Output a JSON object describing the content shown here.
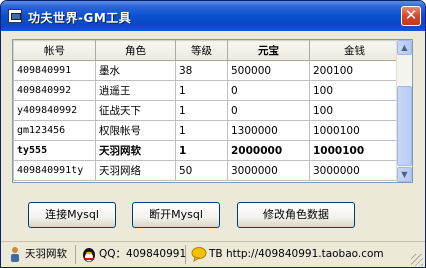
{
  "window": {
    "title": "功夫世界-GM工具",
    "close_symbol": "✕"
  },
  "table": {
    "columns": [
      "帐号",
      "角色",
      "等级",
      "元宝",
      "金钱"
    ],
    "rows": [
      {
        "account": "409840991",
        "role": "墨水",
        "level": "38",
        "yuanbao": "500000",
        "money": "200100",
        "bold": false
      },
      {
        "account": "409840992",
        "role": "逍遥王",
        "level": "1",
        "yuanbao": "0",
        "money": "100",
        "bold": false
      },
      {
        "account": "y409840992",
        "role": "征战天下",
        "level": "1",
        "yuanbao": "0",
        "money": "100",
        "bold": false
      },
      {
        "account": "gm123456",
        "role": "权限帐号",
        "level": "1",
        "yuanbao": "1300000",
        "money": "1000100",
        "bold": false
      },
      {
        "account": "ty555",
        "role": "天羽网软",
        "level": "1",
        "yuanbao": "2000000",
        "money": "1000100",
        "bold": true
      },
      {
        "account": "409840991ty",
        "role": "天羽网络",
        "level": "50",
        "yuanbao": "3000000",
        "money": "3000000",
        "bold": false
      }
    ]
  },
  "buttons": {
    "connect": "连接Mysql",
    "disconnect": "断开Mysql",
    "modify": "修改角色数据"
  },
  "statusbar": {
    "brand": "天羽网软",
    "qq": "QQ：409840991",
    "tb": "TB http://409840991.taobao.com"
  },
  "icons": {
    "title": "app-window-icon",
    "brand": "person-icon",
    "qq": "penguin-icon",
    "tb": "speech-bubble-icon"
  }
}
